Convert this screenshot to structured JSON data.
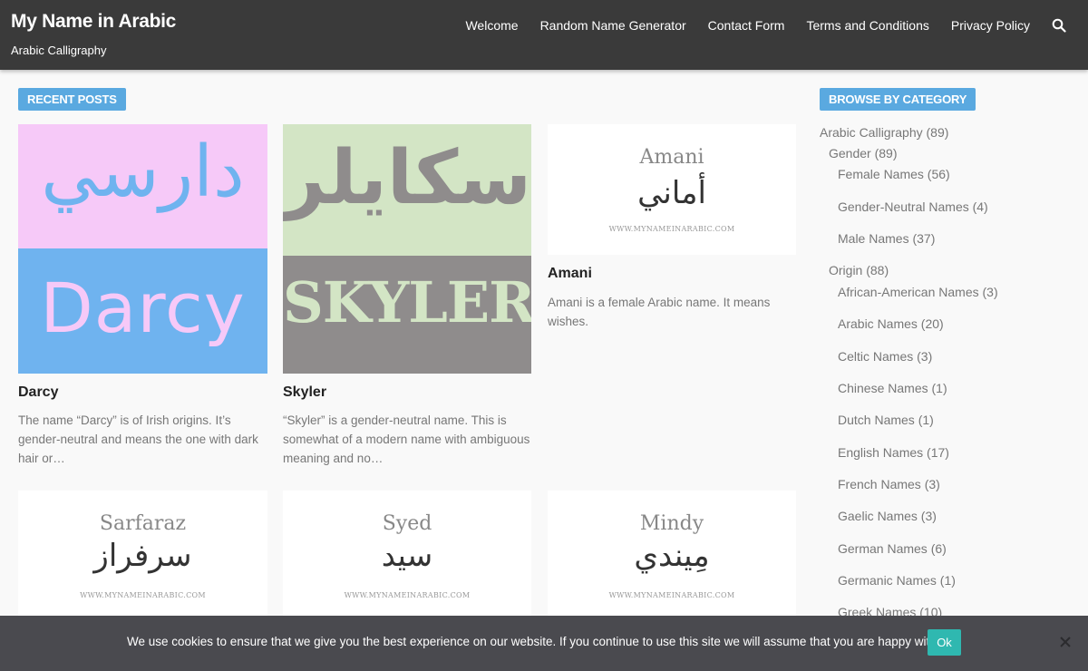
{
  "header": {
    "site_title": "My Name in Arabic",
    "tagline": "Arabic Calligraphy",
    "nav": [
      "Welcome",
      "Random Name Generator",
      "Contact Form",
      "Terms and Conditions",
      "Privacy Policy"
    ],
    "search_icon": "search-icon"
  },
  "recent_posts": {
    "label": "RECENT POSTS",
    "posts": [
      {
        "title": "Darcy",
        "excerpt": "The name “Darcy” is of Irish origins. It’s gender-neutral and means the one with dark hair or…",
        "img_arabic": "دارسي",
        "img_latin": "Darcy",
        "colors": {
          "top": "#f6c9f8",
          "bottom": "#6fb3ef",
          "arabic": "#6fb3ef",
          "latin": "#f6c9f8"
        }
      },
      {
        "title": "Skyler",
        "excerpt": "“Skyler” is a gender-neutral name. This is somewhat of a modern name with ambiguous meaning and no…",
        "img_arabic": "سكايلر",
        "img_latin": "SKYLER",
        "colors": {
          "top": "#d3e5c5",
          "bottom": "#8f8c8c",
          "arabic": "#8f8c8c",
          "latin": "#d3e5c5"
        }
      },
      {
        "title": "Amani",
        "excerpt": "Amani is a female Arabic name. It means wishes.",
        "img_name": "Amani",
        "img_arabic": "أماني",
        "img_url": "WWW.MYNAMEINARABIC.COM"
      },
      {
        "img_name": "Sarfaraz",
        "img_arabic": "سرفراز",
        "img_url": "WWW.MYNAMEINARABIC.COM"
      },
      {
        "img_name": "Syed",
        "img_arabic": "سيد",
        "img_url": "WWW.MYNAMEINARABIC.COM"
      },
      {
        "img_name": "Mindy",
        "img_arabic": "مِيندي",
        "img_url": "WWW.MYNAMEINARABIC.COM"
      }
    ]
  },
  "categories": {
    "label": "BROWSE BY CATEGORY",
    "items": [
      "Arabic Calligraphy (89)",
      "Gender (89)",
      "Female Names (56)",
      "Gender-Neutral Names (4)",
      "Male Names (37)",
      "Origin (88)",
      "African-American Names (3)",
      "Arabic Names (20)",
      "Celtic Names (3)",
      "Chinese Names (1)",
      "Dutch Names (1)",
      "English Names (17)",
      "French Names (3)",
      "Gaelic Names (3)",
      "German Names (6)",
      "Germanic Names (1)",
      "Greek Names (10)"
    ]
  },
  "cookie": {
    "text": "We use cookies to ensure that we give you the best experience on our website. If you continue to use this site we will assume that you are happy with it.",
    "ok_label": "Ok",
    "close_icon": "close-icon"
  }
}
